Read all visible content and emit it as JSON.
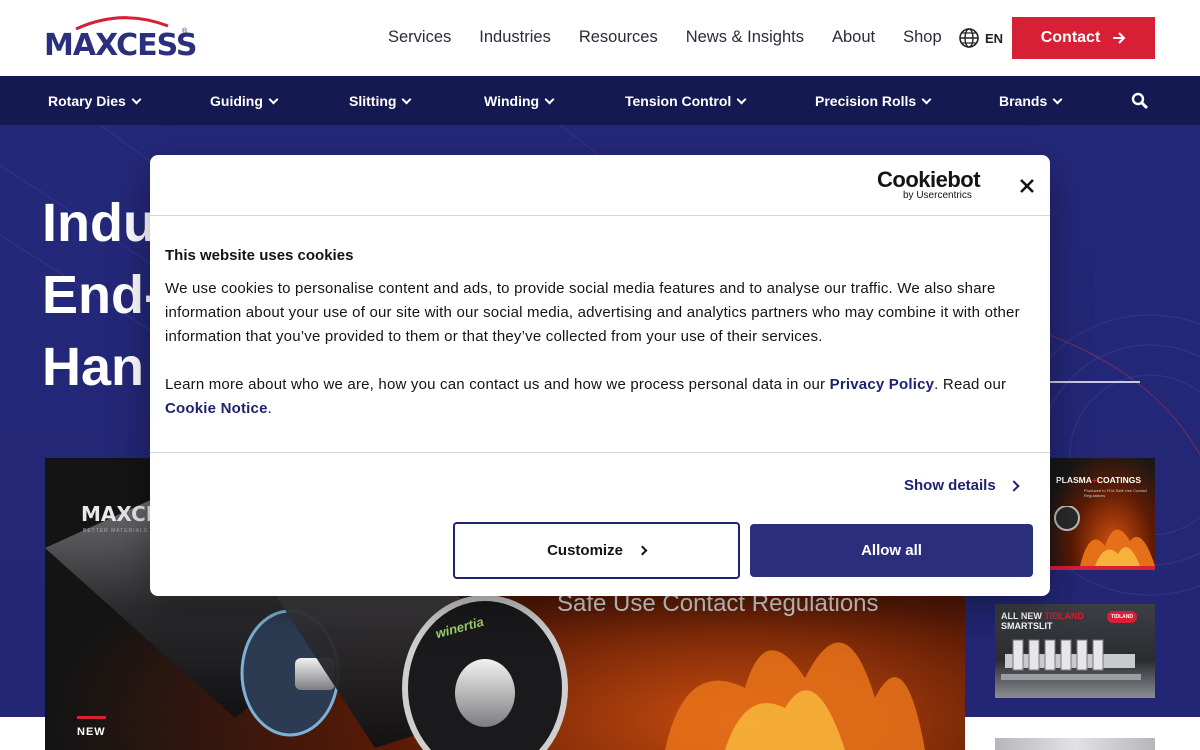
{
  "header": {
    "logo_text": "MAXCESS",
    "logo_reg": "®",
    "nav": [
      "Services",
      "Industries",
      "Resources",
      "News & Insights",
      "About",
      "Shop"
    ],
    "language": "EN",
    "contact_label": "Contact",
    "icons": {
      "globe": "globe-icon",
      "arrow": "arrow-right-icon"
    }
  },
  "subnav": {
    "items": [
      "Rotary Dies",
      "Guiding",
      "Slitting",
      "Winding",
      "Tension Control",
      "Precision Rolls",
      "Brands"
    ],
    "search_icon": "search-icon"
  },
  "hero": {
    "title_lines": [
      "Indu",
      "End-",
      "Han"
    ],
    "feature": {
      "logo_text": "MAXCESS",
      "logo_subtext": "BETTER MATERIALS",
      "caption": "Safe Use Contact Regulations",
      "product_label": "winertia",
      "badge": "NEW"
    },
    "thumbs": {
      "plasma_title_a": "PLASMA",
      "plasma_title_b": "COATINGS",
      "plasma_sub": "Produced to FDA Safe Use Contact Regulations",
      "tidland_title_a": "ALL NEW",
      "tidland_title_b": "TIDLAND",
      "tidland_title_c": "SMARTSLIT",
      "tidland_tag": "TIDLAND"
    }
  },
  "cookie_dialog": {
    "brand": "Cookiebot",
    "brand_by": "by Usercentrics",
    "title": "This website uses cookies",
    "text": "We use cookies to personalise content and ads, to provide social media features and to analyse our traffic. We also share information about your use of our site with our social media, advertising and analytics partners who may combine it with other information that you’ve provided to them or that they’ve collected from your use of their services.",
    "learn_prefix": "Learn more about who we are, how you can contact us and how we process personal data in our ",
    "privacy_link": "Privacy Policy",
    "read_text": ". Read our ",
    "cookie_link": "Cookie Notice",
    "period": ".",
    "show_details": "Show details",
    "customize": "Customize",
    "allow_all": "Allow all",
    "close_icon": "close-icon"
  },
  "colors": {
    "brand_navy": "#2a2f7e",
    "subnav_bg": "#151951",
    "hero_bg": "#24287a",
    "accent_red": "#d71f35",
    "allow_btn": "#2b2e7c"
  }
}
